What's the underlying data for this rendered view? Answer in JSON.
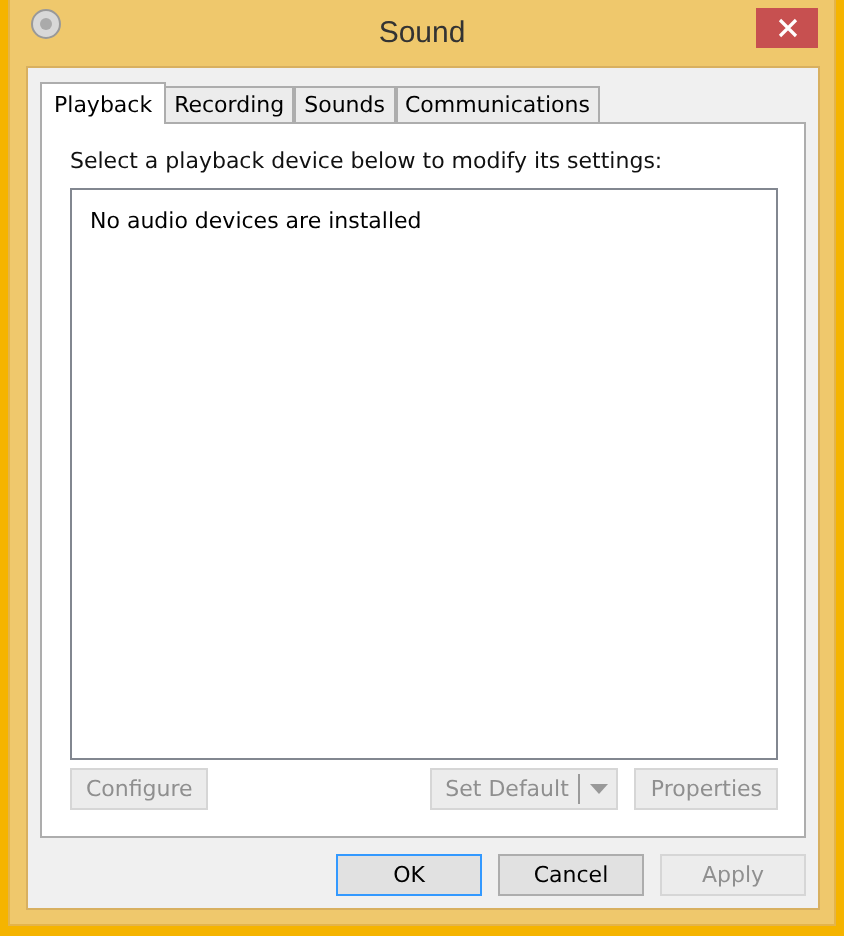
{
  "window": {
    "title": "Sound"
  },
  "tabs": [
    {
      "label": "Playback",
      "selected": true
    },
    {
      "label": "Recording",
      "selected": false
    },
    {
      "label": "Sounds",
      "selected": false
    },
    {
      "label": "Communications",
      "selected": false
    }
  ],
  "instruction": "Select a playback device below to modify its settings:",
  "device_list": {
    "empty_message": "No audio devices are installed"
  },
  "device_buttons": [
    {
      "label": "Configure",
      "disabled": true,
      "kind": "plain"
    },
    {
      "label": "Set Default",
      "disabled": true,
      "kind": "split"
    },
    {
      "label": "Properties",
      "disabled": true,
      "kind": "plain"
    }
  ],
  "dialog_buttons": [
    {
      "label": "OK",
      "disabled": false,
      "default": true
    },
    {
      "label": "Cancel",
      "disabled": false,
      "default": false
    },
    {
      "label": "Apply",
      "disabled": true,
      "default": false
    }
  ]
}
